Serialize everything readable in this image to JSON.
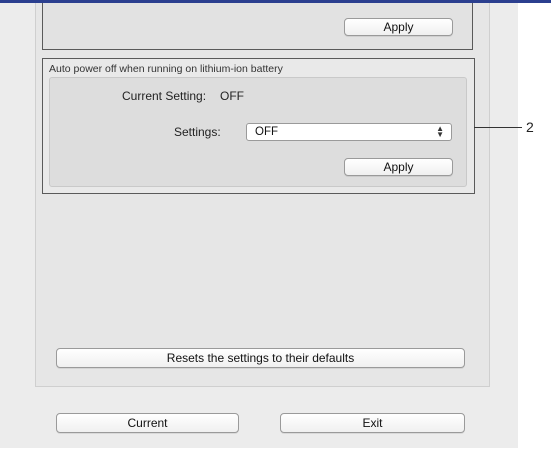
{
  "top_group": {
    "apply_label": "Apply"
  },
  "auto_power_group": {
    "legend": "Auto power off when running on lithium-ion battery",
    "current_setting_label": "Current Setting:",
    "current_setting_value": "OFF",
    "settings_label": "Settings:",
    "settings_selected": "OFF",
    "apply_label": "Apply"
  },
  "reset_button_label": "Resets the settings to their defaults",
  "footer": {
    "current_label": "Current",
    "exit_label": "Exit"
  },
  "callout": {
    "number": "2"
  },
  "colors": {
    "top_bar": "#2b3f8f",
    "window_bg": "#ececec",
    "panel_bg": "#e6e6e6"
  },
  "icons": {
    "select_arrows": "up-down-chevron-icon"
  }
}
